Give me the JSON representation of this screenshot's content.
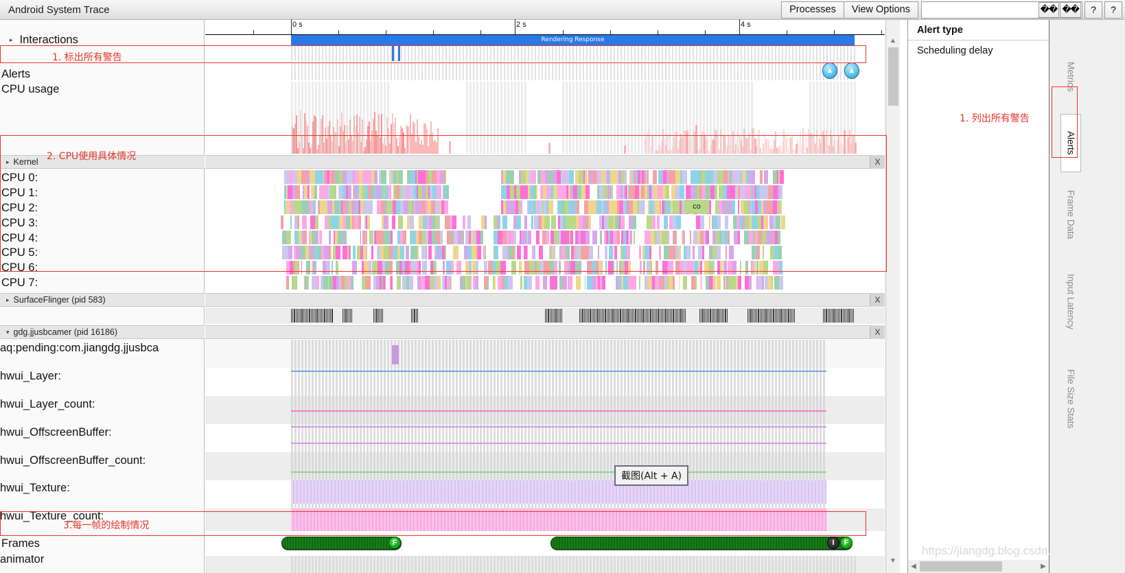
{
  "window": {
    "title": "Android System Trace"
  },
  "toolbar": {
    "processes_label": "Processes",
    "view_options_label": "View Options",
    "search_value": "",
    "search_placeholder": "",
    "glyph_btn_1": "��",
    "glyph_btn_2": "��",
    "help_btn_1": "?",
    "help_btn_2": "?"
  },
  "ruler": {
    "labels": [
      "0 s",
      "2 s",
      "4 s"
    ],
    "rendering_response_label": "Rendering Response"
  },
  "tracks": {
    "interactions": "Interactions",
    "alerts": "Alerts",
    "cpu_usage": "CPU usage",
    "kernel_group": "Kernel",
    "cpu_rows": [
      "CPU 0:",
      "CPU 1:",
      "CPU 2:",
      "CPU 3:",
      "CPU 4:",
      "CPU 5:",
      "CPU 6:",
      "CPU 7:"
    ],
    "surfaceflinger_group": "SurfaceFlinger (pid 583)",
    "process_group": "gdg.jjusbcamer (pid 16186)",
    "process_rows": [
      "aq:pending:com.jiangdg.jjusbca",
      "hwui_Layer:",
      "hwui_Layer_count:",
      "hwui_OffscreenBuffer:",
      "hwui_OffscreenBuffer_count:",
      "hwui_Texture:",
      "hwui_Texture_count:"
    ],
    "frames": "Frames",
    "animator": "animator",
    "close_label": "X",
    "cpu_slice_label": "co",
    "frame_marker_f": "F",
    "frame_marker_i": "I"
  },
  "annotations": [
    {
      "text": "1. 标出所有警告"
    },
    {
      "text": "2. CPU使用具体情况"
    },
    {
      "text": "3.每一帧的绘制情况"
    },
    {
      "text": "1. 列出所有警告"
    }
  ],
  "tooltip": {
    "text": "截图(Alt + A)"
  },
  "details_panel": {
    "header": "Alert type",
    "items": [
      "Scheduling delay"
    ]
  },
  "side_tabs": [
    {
      "label": "Metrics",
      "active": false
    },
    {
      "label": "Alerts",
      "active": true
    },
    {
      "label": "Frame Data",
      "active": false
    },
    {
      "label": "Input Latency",
      "active": false
    },
    {
      "label": "File Size Stats",
      "active": false
    }
  ],
  "watermark": {
    "text": "https://jiangdg.blog.csdn.net"
  },
  "colors": {
    "accent_blue": "#2979e8",
    "annotation_red": "#e8342a",
    "cpu_usage_pink": "#f9b6b6",
    "frame_green": "#0a8a0a",
    "alert_badge_blue": "#5cc4ef"
  }
}
